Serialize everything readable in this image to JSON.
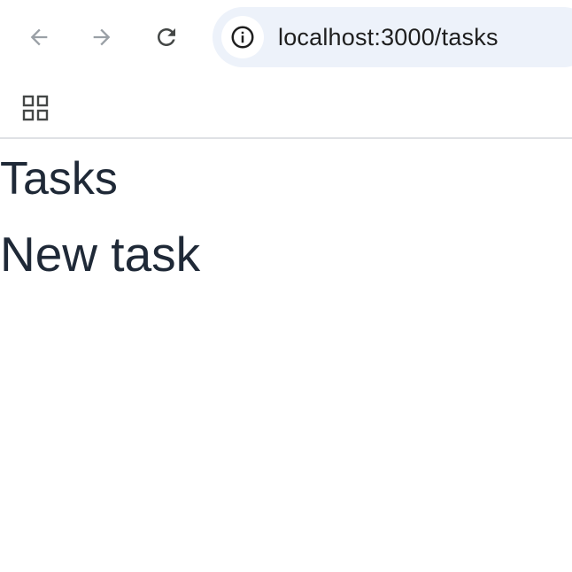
{
  "browser": {
    "url": "localhost:3000/tasks",
    "icons": {
      "back": "arrow-left-icon",
      "forward": "arrow-right-icon",
      "reload": "reload-icon",
      "site_info": "info-circle-icon",
      "apps": "apps-grid-icon"
    },
    "colors": {
      "omnibox_bg": "#edf2fa",
      "nav_disabled": "#9aa0a6",
      "nav_enabled": "#444746"
    }
  },
  "page": {
    "title": "Tasks",
    "new_task_label": "New task",
    "text_color": "#1f2937"
  }
}
